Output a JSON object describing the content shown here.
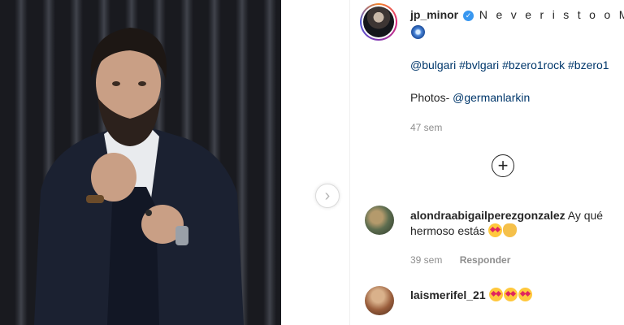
{
  "post": {
    "username": "jp_minor",
    "caption_text": "N e v e r i s t o o M u c h",
    "mentions": [
      "@bulgari",
      "#bvlgari",
      "#bzero1rock",
      "#bzero1"
    ],
    "photos_label": "Photos-",
    "photos_credit": "@germanlarkin",
    "time_ago": "47 sem"
  },
  "comments": [
    {
      "username": "alondraabigailperezgonzalez",
      "text": "Ay qué hermoso estás",
      "time_ago": "39 sem",
      "reply_label": "Responder"
    },
    {
      "username": "laismerifel_21"
    }
  ],
  "icons": {
    "verified": "verified-badge-icon",
    "add": "plus-circle-icon",
    "next": "chevron-right-icon",
    "like": "heart-icon"
  },
  "colors": {
    "link": "#00376b",
    "verified": "#3897f0",
    "muted": "#8e8e8e"
  }
}
